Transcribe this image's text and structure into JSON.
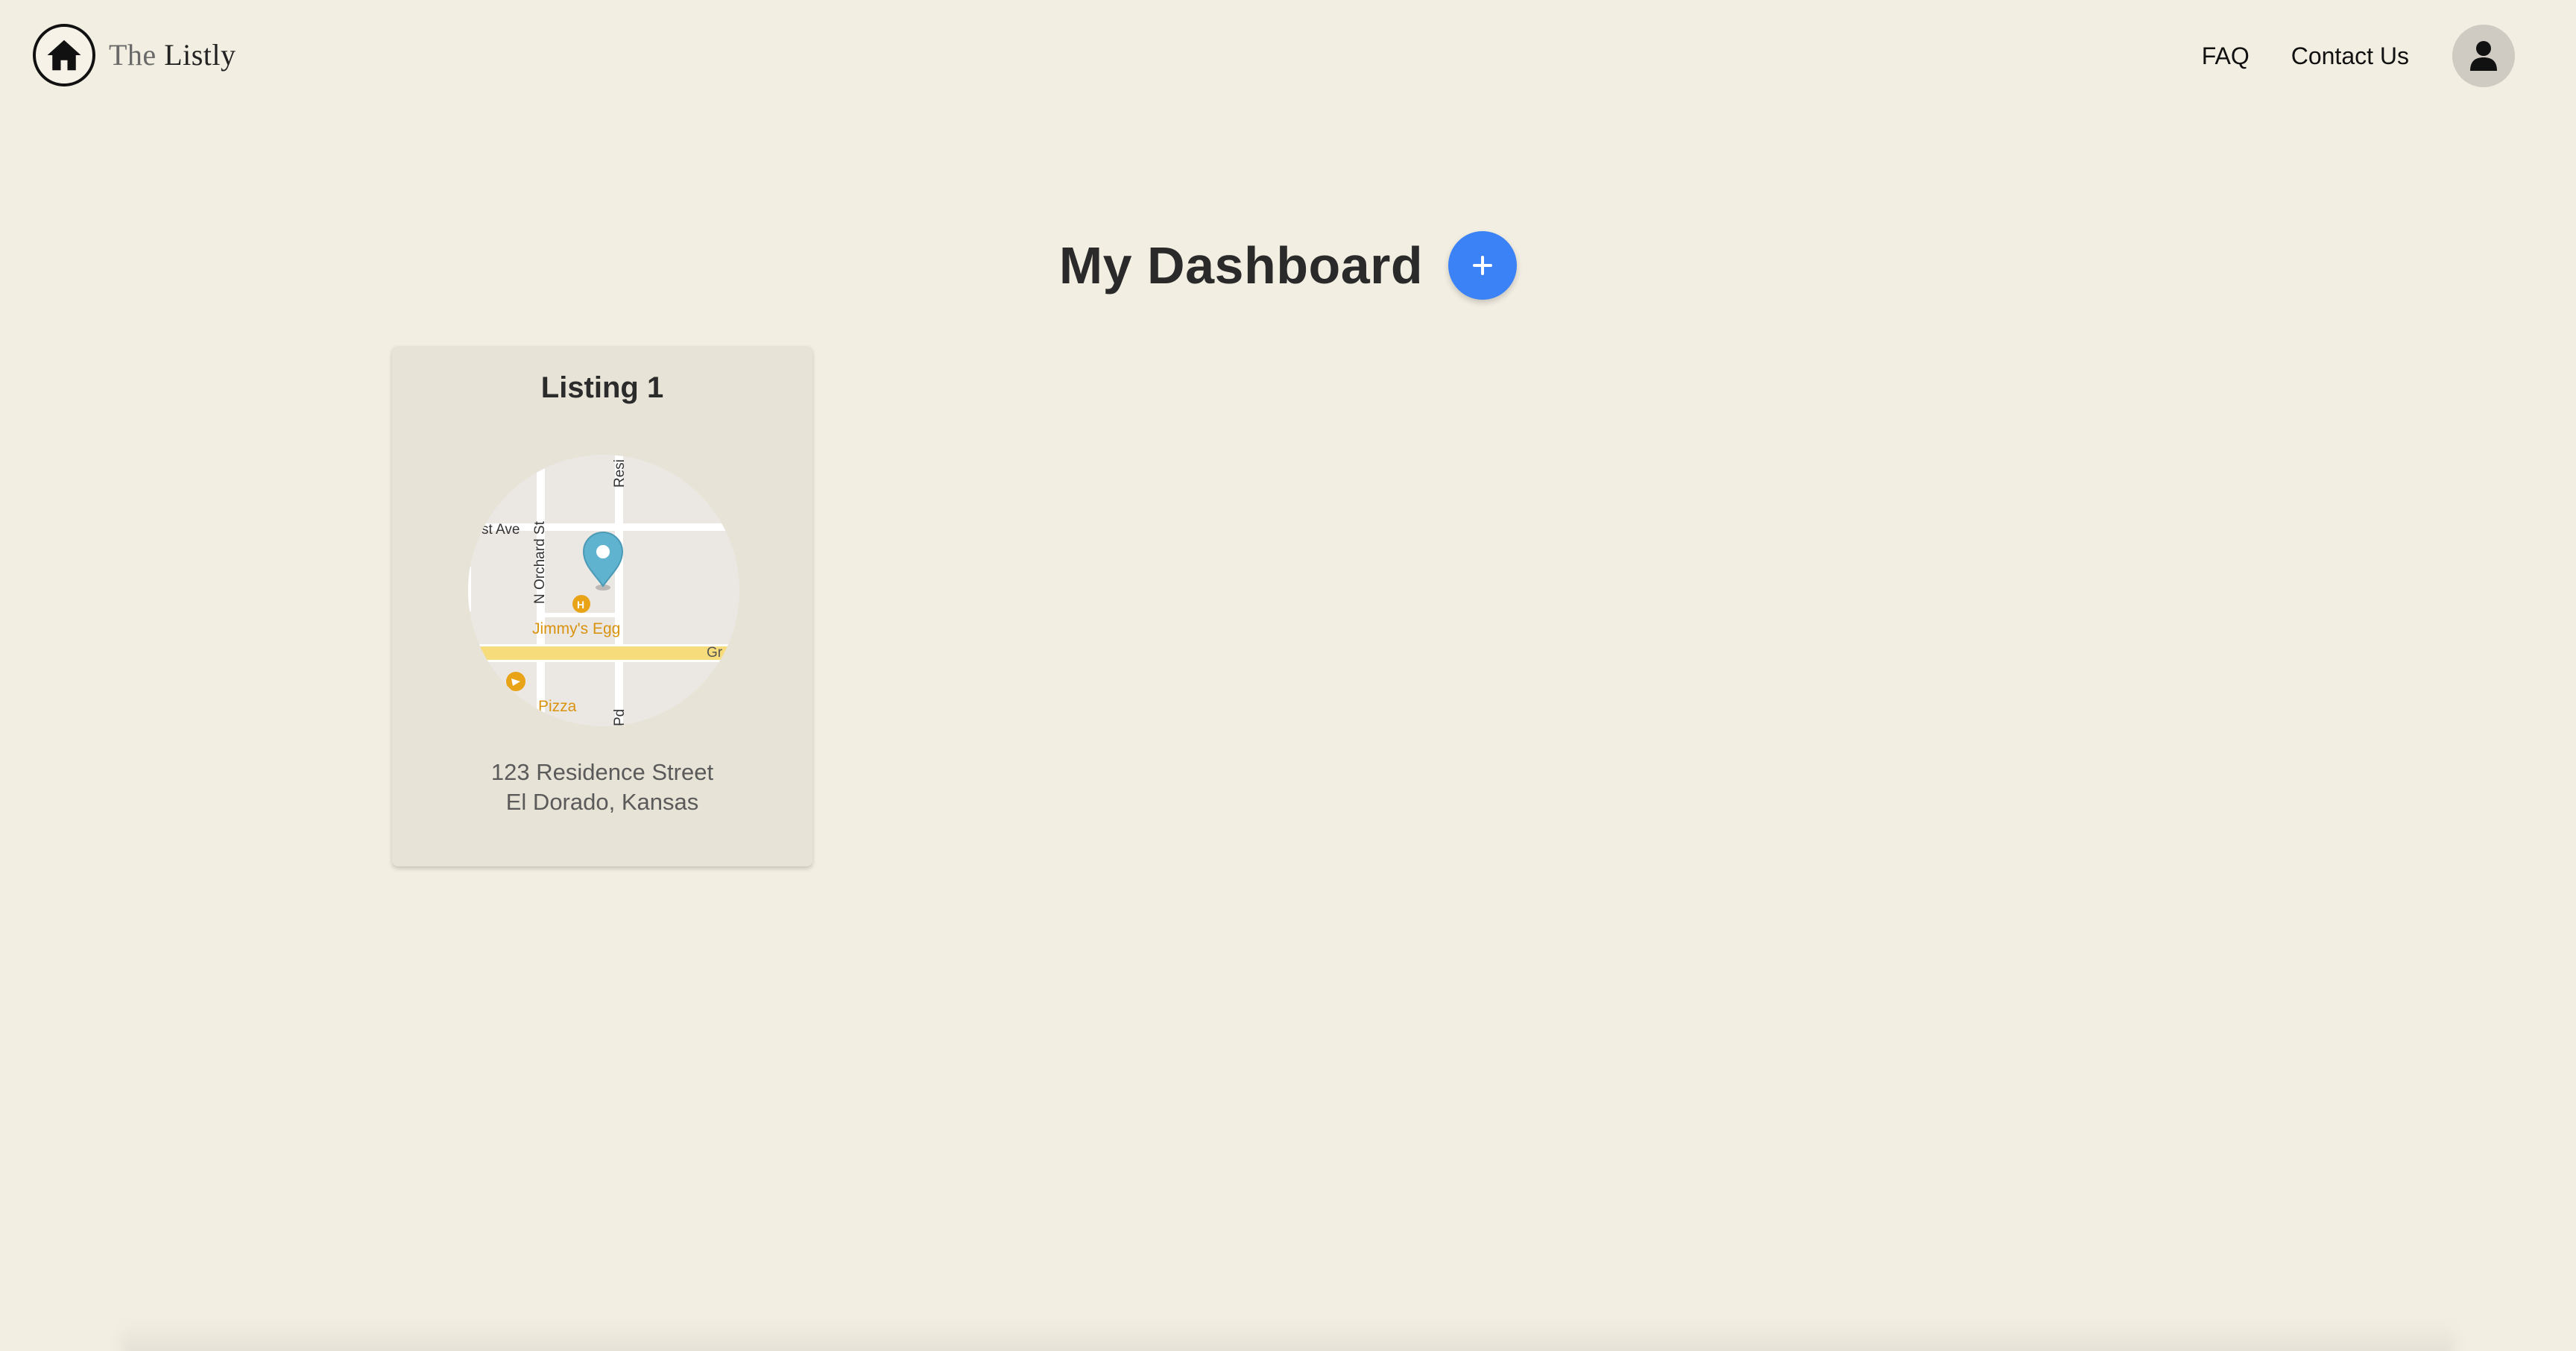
{
  "header": {
    "logo": {
      "the": "The",
      "brand": "Listly"
    },
    "nav": {
      "faq": "FAQ",
      "contact": "Contact Us"
    }
  },
  "dashboard": {
    "title": "My Dashboard",
    "add_label": "+"
  },
  "listings": [
    {
      "title": "Listing 1",
      "address_line1": "123 Residence Street",
      "address_line2": "El Dorado, Kansas",
      "map": {
        "streets": [
          "st Ave",
          "N Orchard St",
          "Resi",
          "Gr",
          "Pd"
        ],
        "places": [
          "Jimmy's Egg",
          "Pizza"
        ]
      }
    }
  ],
  "colors": {
    "background": "#f3eee2",
    "card": "#e8e3d7",
    "accent": "#3b82f6",
    "pin": "#5fb3cf",
    "map_place": "#e8a317",
    "map_road_major": "#f6dc7a"
  }
}
